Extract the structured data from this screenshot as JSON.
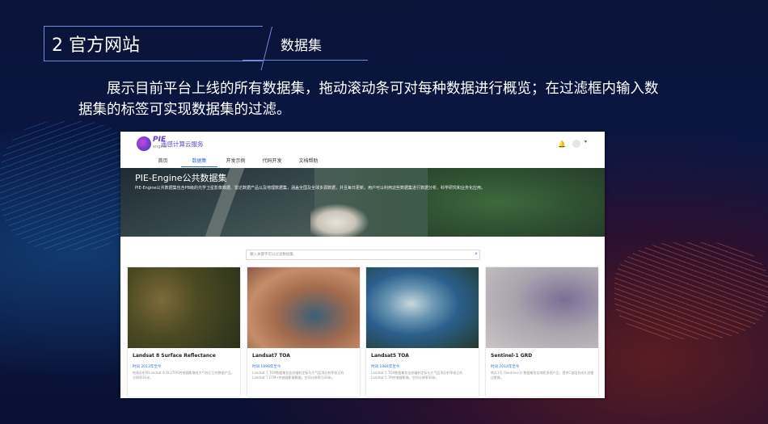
{
  "slide": {
    "heading": "2 官方网站",
    "subheading": "数据集",
    "description": "展示目前平台上线的所有数据集，拖动滚动条可对每种数据进行概览；在过滤框内输入数据集的标签可实现数据集的过滤。"
  },
  "app": {
    "logo_text": "PIE",
    "logo_sub": "engine",
    "brand": "遥感计算云服务",
    "menu": [
      "首页",
      "数据集",
      "开发示例",
      "代码开发",
      "文档帮助"
    ],
    "active_menu": "数据集"
  },
  "hero": {
    "title": "PIE-Engine公共数据集",
    "description": "PIE-Engine公共数据集包含PB级的光学卫星影像数据、雷达数据产品以及地理数据集，涵盖全国及全球多源数据，并且每日更新，用户可以利用这些数据集进行数据分析、科学研究和业务化应用。"
  },
  "search": {
    "placeholder": "输入关键字可以过滤数据集"
  },
  "cards": [
    {
      "title": "Landsat 8 Surface Reflectance",
      "date": "时间 2013年至今",
      "desc": "地表反射率Landsat 8 OLI/TIRS传感器影像经大气校正后的数据产品。分辨率30米。"
    },
    {
      "title": "Landsat7 TOA",
      "date": "时间 1999年至今",
      "desc": "Landsat 7 TOA数据集包含经辐射定标与大气层顶反射率校正的Landsat 7 ETM+传感器影像数据，空间分辨率为30米。"
    },
    {
      "title": "Landsat5 TOA",
      "date": "时间 1984年至今",
      "desc": "Landsat 5 TOA数据集包含经辐射定标与大气层顶反射率校正的Landsat 5 TM传感器影像，空间分辨率30米。"
    },
    {
      "title": "Sentinel-1 GRD",
      "date": "时间 2014年至今",
      "desc": "哨兵1号 (Sentinel-1) 数据集包含地距多视产品，提供C波段合成孔径雷达影像。"
    }
  ],
  "colors": {
    "accent": "#2f6fd6",
    "slide_bg": "#0a1948"
  }
}
